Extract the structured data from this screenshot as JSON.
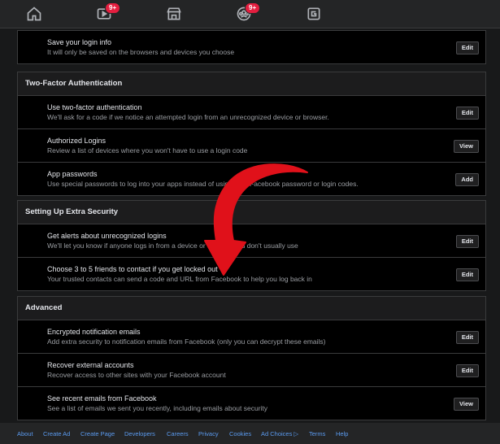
{
  "nav": {
    "badge_watch": "9+",
    "badge_groups": "9+",
    "icons": [
      "home-icon",
      "watch-icon",
      "marketplace-icon",
      "groups-icon",
      "gaming-icon"
    ]
  },
  "sections": {
    "login": {
      "rows": [
        {
          "title": "Save your login info",
          "desc": "It will only be saved on the browsers and devices you choose",
          "button": "Edit"
        }
      ]
    },
    "two_factor": {
      "header": "Two-Factor Authentication",
      "rows": [
        {
          "title": "Use two-factor authentication",
          "desc": "We'll ask for a code if we notice an attempted login from an unrecognized device or browser.",
          "button": "Edit"
        },
        {
          "title": "Authorized Logins",
          "desc": "Review a list of devices where you won't have to use a login code",
          "button": "View"
        },
        {
          "title": "App passwords",
          "desc": "Use special passwords to log into your apps instead of using your Facebook password or login codes.",
          "button": "Add"
        }
      ]
    },
    "extra_security": {
      "header": "Setting Up Extra Security",
      "rows": [
        {
          "title": "Get alerts about unrecognized logins",
          "desc": "We'll let you know if anyone logs in from a device or browser you don't usually use",
          "button": "Edit"
        },
        {
          "title": "Choose 3 to 5 friends to contact if you get locked out",
          "desc": "Your trusted contacts can send a code and URL from Facebook to help you log back in",
          "button": "Edit"
        }
      ]
    },
    "advanced": {
      "header": "Advanced",
      "rows": [
        {
          "title": "Encrypted notification emails",
          "desc": "Add extra security to notification emails from Facebook (only you can decrypt these emails)",
          "button": "Edit"
        },
        {
          "title": "Recover external accounts",
          "desc": "Recover access to other sites with your Facebook account",
          "button": "Edit"
        },
        {
          "title": "See recent emails from Facebook",
          "desc": "See a list of emails we sent you recently, including emails about security",
          "button": "View"
        }
      ]
    }
  },
  "footer": {
    "links": [
      "About",
      "Create Ad",
      "Create Page",
      "Developers",
      "Careers",
      "Privacy",
      "Cookies",
      "Ad Choices ▷",
      "Terms",
      "Help"
    ]
  },
  "colors": {
    "background": "#18191a",
    "panel": "#000000",
    "link": "#5b9bf0",
    "badge": "#e41e3f",
    "arrow": "#e0111a"
  }
}
